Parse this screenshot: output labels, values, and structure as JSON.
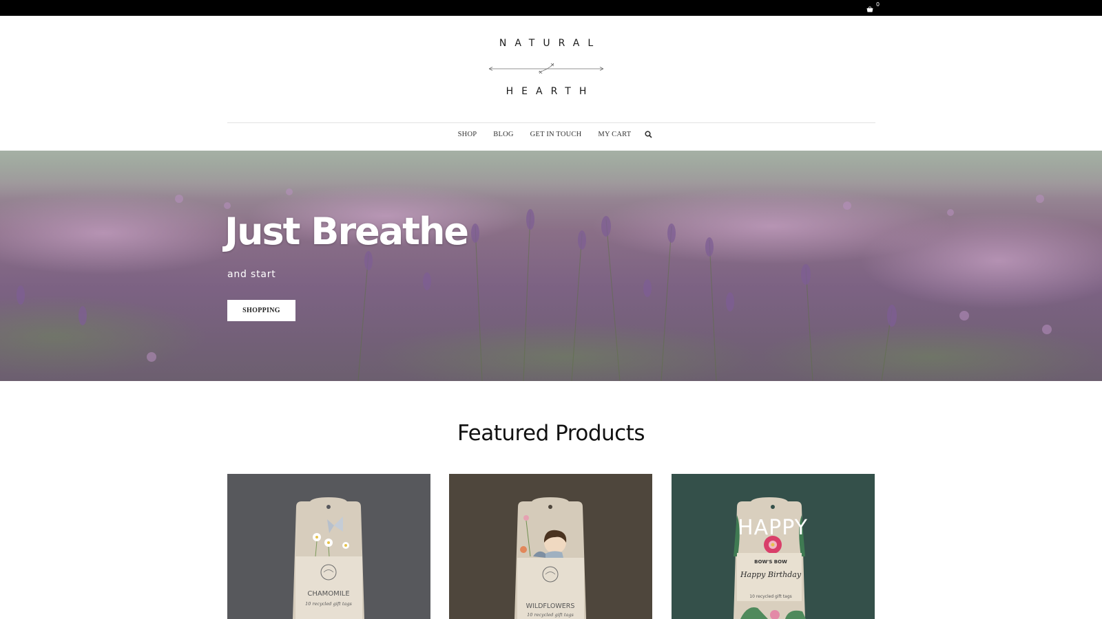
{
  "topbar": {
    "cart_count": "0",
    "cart_icon": "basket-icon"
  },
  "logo": {
    "line1": "NATURAL",
    "line2": "HEARTH"
  },
  "nav": {
    "items": [
      {
        "label": "SHOP"
      },
      {
        "label": "BLOG"
      },
      {
        "label": "GET IN TOUCH"
      },
      {
        "label": "MY CART"
      }
    ],
    "search_icon": "search-icon"
  },
  "hero": {
    "title": "Just Breathe",
    "subtitle": "and start",
    "button_label": "SHOPPING"
  },
  "featured": {
    "title": "Featured Products",
    "products": [
      {
        "tag_text": "CHAMOMILE",
        "tag_subtext": "10 recycled gift tags",
        "bg_color": "#57585c"
      },
      {
        "tag_text": "WILDFLOWERS",
        "tag_subtext": "10 recycled gift tags",
        "bg_color": "#4e463c"
      },
      {
        "tag_text": "HAPPY",
        "tag_band": "BOW'S BOW",
        "tag_script": "Happy Birthday",
        "tag_subtext": "10 recycled gift tags",
        "bg_color": "#34504a"
      }
    ]
  },
  "colors": {
    "topbar": "#000000",
    "accent_text": "#222222"
  }
}
